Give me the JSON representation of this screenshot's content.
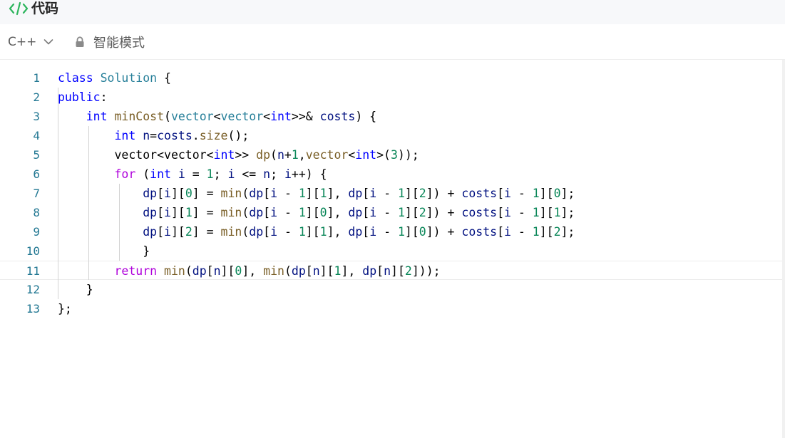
{
  "header": {
    "title": "代码",
    "icon": "code-brackets-icon",
    "accent": "#2db55d"
  },
  "toolbar": {
    "language": "C++",
    "mode_label": "智能模式"
  },
  "editor": {
    "current_line": 11,
    "lines": [
      {
        "n": "1",
        "tokens": [
          [
            "kw",
            "class"
          ],
          [
            "plain",
            " "
          ],
          [
            "type",
            "Solution"
          ],
          [
            "plain",
            " {"
          ]
        ]
      },
      {
        "n": "2",
        "tokens": [
          [
            "kw",
            "public"
          ],
          [
            "plain",
            ":"
          ]
        ]
      },
      {
        "n": "3",
        "tokens": [
          [
            "plain",
            "    "
          ],
          [
            "kw",
            "int"
          ],
          [
            "plain",
            " "
          ],
          [
            "fn",
            "minCost"
          ],
          [
            "plain",
            "("
          ],
          [
            "type",
            "vector"
          ],
          [
            "plain",
            "<"
          ],
          [
            "type",
            "vector"
          ],
          [
            "plain",
            "<"
          ],
          [
            "kw",
            "int"
          ],
          [
            "plain",
            ">>& "
          ],
          [
            "var",
            "costs"
          ],
          [
            "plain",
            ") {"
          ]
        ]
      },
      {
        "n": "4",
        "tokens": [
          [
            "plain",
            "        "
          ],
          [
            "kw",
            "int"
          ],
          [
            "plain",
            " "
          ],
          [
            "var",
            "n"
          ],
          [
            "plain",
            "="
          ],
          [
            "var",
            "costs"
          ],
          [
            "plain",
            "."
          ],
          [
            "fn",
            "size"
          ],
          [
            "plain",
            "();"
          ]
        ]
      },
      {
        "n": "5",
        "tokens": [
          [
            "plain",
            "        vector<vector<"
          ],
          [
            "kw",
            "int"
          ],
          [
            "plain",
            ">> "
          ],
          [
            "fn",
            "dp"
          ],
          [
            "plain",
            "("
          ],
          [
            "var",
            "n"
          ],
          [
            "plain",
            "+"
          ],
          [
            "num",
            "1"
          ],
          [
            "plain",
            ","
          ],
          [
            "fn",
            "vector"
          ],
          [
            "plain",
            "<"
          ],
          [
            "kw",
            "int"
          ],
          [
            "plain",
            ">("
          ],
          [
            "num",
            "3"
          ],
          [
            "plain",
            "));"
          ]
        ]
      },
      {
        "n": "6",
        "tokens": [
          [
            "plain",
            "        "
          ],
          [
            "ctrl",
            "for"
          ],
          [
            "plain",
            " ("
          ],
          [
            "kw",
            "int"
          ],
          [
            "plain",
            " "
          ],
          [
            "var",
            "i"
          ],
          [
            "plain",
            " = "
          ],
          [
            "num",
            "1"
          ],
          [
            "plain",
            "; "
          ],
          [
            "var",
            "i"
          ],
          [
            "plain",
            " <= "
          ],
          [
            "var",
            "n"
          ],
          [
            "plain",
            "; "
          ],
          [
            "var",
            "i"
          ],
          [
            "plain",
            "++) {"
          ]
        ]
      },
      {
        "n": "7",
        "tokens": [
          [
            "plain",
            "            "
          ],
          [
            "var",
            "dp"
          ],
          [
            "plain",
            "["
          ],
          [
            "var",
            "i"
          ],
          [
            "plain",
            "]["
          ],
          [
            "num",
            "0"
          ],
          [
            "plain",
            "] = "
          ],
          [
            "fn",
            "min"
          ],
          [
            "plain",
            "("
          ],
          [
            "var",
            "dp"
          ],
          [
            "plain",
            "["
          ],
          [
            "var",
            "i"
          ],
          [
            "plain",
            " - "
          ],
          [
            "num",
            "1"
          ],
          [
            "plain",
            "]["
          ],
          [
            "num",
            "1"
          ],
          [
            "plain",
            "], "
          ],
          [
            "var",
            "dp"
          ],
          [
            "plain",
            "["
          ],
          [
            "var",
            "i"
          ],
          [
            "plain",
            " - "
          ],
          [
            "num",
            "1"
          ],
          [
            "plain",
            "]["
          ],
          [
            "num",
            "2"
          ],
          [
            "plain",
            "]) + "
          ],
          [
            "var",
            "costs"
          ],
          [
            "plain",
            "["
          ],
          [
            "var",
            "i"
          ],
          [
            "plain",
            " - "
          ],
          [
            "num",
            "1"
          ],
          [
            "plain",
            "]["
          ],
          [
            "num",
            "0"
          ],
          [
            "plain",
            "];"
          ]
        ]
      },
      {
        "n": "8",
        "tokens": [
          [
            "plain",
            "            "
          ],
          [
            "var",
            "dp"
          ],
          [
            "plain",
            "["
          ],
          [
            "var",
            "i"
          ],
          [
            "plain",
            "]["
          ],
          [
            "num",
            "1"
          ],
          [
            "plain",
            "] = "
          ],
          [
            "fn",
            "min"
          ],
          [
            "plain",
            "("
          ],
          [
            "var",
            "dp"
          ],
          [
            "plain",
            "["
          ],
          [
            "var",
            "i"
          ],
          [
            "plain",
            " - "
          ],
          [
            "num",
            "1"
          ],
          [
            "plain",
            "]["
          ],
          [
            "num",
            "0"
          ],
          [
            "plain",
            "], "
          ],
          [
            "var",
            "dp"
          ],
          [
            "plain",
            "["
          ],
          [
            "var",
            "i"
          ],
          [
            "plain",
            " - "
          ],
          [
            "num",
            "1"
          ],
          [
            "plain",
            "]["
          ],
          [
            "num",
            "2"
          ],
          [
            "plain",
            "]) + "
          ],
          [
            "var",
            "costs"
          ],
          [
            "plain",
            "["
          ],
          [
            "var",
            "i"
          ],
          [
            "plain",
            " - "
          ],
          [
            "num",
            "1"
          ],
          [
            "plain",
            "]["
          ],
          [
            "num",
            "1"
          ],
          [
            "plain",
            "];"
          ]
        ]
      },
      {
        "n": "9",
        "tokens": [
          [
            "plain",
            "            "
          ],
          [
            "var",
            "dp"
          ],
          [
            "plain",
            "["
          ],
          [
            "var",
            "i"
          ],
          [
            "plain",
            "]["
          ],
          [
            "num",
            "2"
          ],
          [
            "plain",
            "] = "
          ],
          [
            "fn",
            "min"
          ],
          [
            "plain",
            "("
          ],
          [
            "var",
            "dp"
          ],
          [
            "plain",
            "["
          ],
          [
            "var",
            "i"
          ],
          [
            "plain",
            " - "
          ],
          [
            "num",
            "1"
          ],
          [
            "plain",
            "]["
          ],
          [
            "num",
            "1"
          ],
          [
            "plain",
            "], "
          ],
          [
            "var",
            "dp"
          ],
          [
            "plain",
            "["
          ],
          [
            "var",
            "i"
          ],
          [
            "plain",
            " - "
          ],
          [
            "num",
            "1"
          ],
          [
            "plain",
            "]["
          ],
          [
            "num",
            "0"
          ],
          [
            "plain",
            "]) + "
          ],
          [
            "var",
            "costs"
          ],
          [
            "plain",
            "["
          ],
          [
            "var",
            "i"
          ],
          [
            "plain",
            " - "
          ],
          [
            "num",
            "1"
          ],
          [
            "plain",
            "]["
          ],
          [
            "num",
            "2"
          ],
          [
            "plain",
            "];"
          ]
        ]
      },
      {
        "n": "10",
        "tokens": [
          [
            "plain",
            "            }"
          ]
        ]
      },
      {
        "n": "11",
        "tokens": [
          [
            "plain",
            "        "
          ],
          [
            "ctrl",
            "return"
          ],
          [
            "plain",
            " "
          ],
          [
            "fn",
            "min"
          ],
          [
            "plain",
            "("
          ],
          [
            "var",
            "dp"
          ],
          [
            "plain",
            "["
          ],
          [
            "var",
            "n"
          ],
          [
            "plain",
            "]["
          ],
          [
            "num",
            "0"
          ],
          [
            "plain",
            "], "
          ],
          [
            "fn",
            "min"
          ],
          [
            "plain",
            "("
          ],
          [
            "var",
            "dp"
          ],
          [
            "plain",
            "["
          ],
          [
            "var",
            "n"
          ],
          [
            "plain",
            "]["
          ],
          [
            "num",
            "1"
          ],
          [
            "plain",
            "], "
          ],
          [
            "var",
            "dp"
          ],
          [
            "plain",
            "["
          ],
          [
            "var",
            "n"
          ],
          [
            "plain",
            "]["
          ],
          [
            "num",
            "2"
          ],
          [
            "plain",
            "]));"
          ]
        ]
      },
      {
        "n": "12",
        "tokens": [
          [
            "plain",
            "    }"
          ]
        ]
      },
      {
        "n": "13",
        "tokens": [
          [
            "plain",
            "};"
          ]
        ]
      }
    ]
  }
}
